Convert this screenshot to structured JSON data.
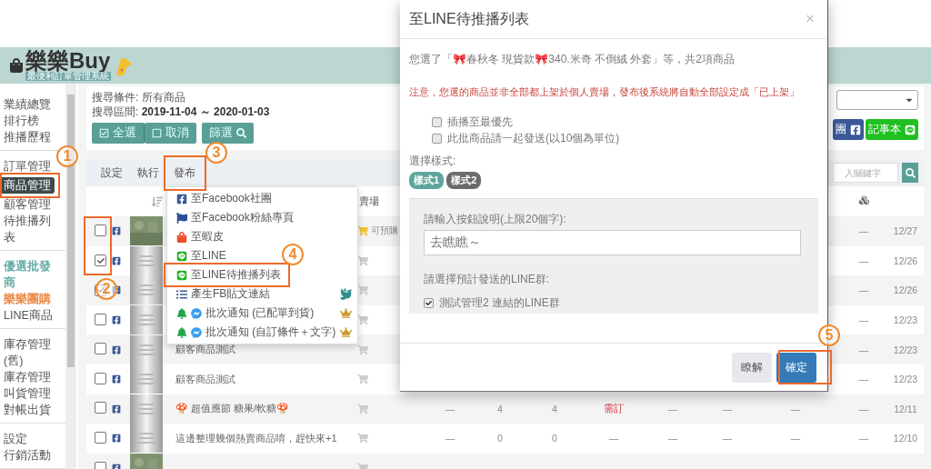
{
  "header": {
    "logo": "樂樂Buy",
    "tagline": "最便利訂單管理系統"
  },
  "sidebar": {
    "groups": [
      [
        {
          "label": "業績總覽",
          "selected": false
        },
        {
          "label": "排行榜",
          "selected": false
        },
        {
          "label": "推播歷程",
          "selected": false
        }
      ],
      [
        {
          "label": "訂單管理",
          "selected": false
        },
        {
          "label": "商品管理",
          "selected": true
        },
        {
          "label": "顧客管理",
          "selected": false
        },
        {
          "label": "待推播列表",
          "selected": false
        }
      ],
      [
        {
          "label": "優選批發商",
          "selected": false,
          "color": "#5aa8a0"
        },
        {
          "label": "樂樂團購",
          "selected": false,
          "color": "#e8823a"
        },
        {
          "label": "LINE商品",
          "selected": false
        }
      ],
      [
        {
          "label": "庫存管理(舊)",
          "selected": false
        },
        {
          "label": "庫存管理",
          "selected": false
        },
        {
          "label": "叫貨管理",
          "selected": false
        },
        {
          "label": "對帳出貨",
          "selected": false
        }
      ],
      [
        {
          "label": "設定",
          "selected": false
        },
        {
          "label": "行銷活動",
          "selected": false
        }
      ]
    ]
  },
  "search": {
    "condition": "搜尋條件: 所有商品",
    "range": "搜尋區間: **2019-11-04 ～ 2020-01-03**",
    "buttons": [
      {
        "label": "全選",
        "kind": "check"
      },
      {
        "label": "取消",
        "kind": "uncheck"
      }
    ],
    "filter": "篩選"
  },
  "share_buttons": [
    {
      "label": "團",
      "kind": "facebook"
    },
    {
      "label": "記事本",
      "kind": "line"
    }
  ],
  "toolbar": {
    "tabs": [
      {
        "label": "設定"
      },
      {
        "label": "執行"
      },
      {
        "label": "發布"
      }
    ],
    "search_placeholder": "入關鍵字"
  },
  "table": {
    "store_heading": "賣場",
    "rows": [
      {
        "checked": false,
        "preorder": "可預購",
        "cells": [
          "—",
          "12/27"
        ]
      },
      {
        "checked": true,
        "kind": "placeholder",
        "cells": [
          "—",
          "12/26"
        ]
      },
      {
        "checked": true,
        "kind": "placeholder",
        "cells": [
          "—",
          "12/26"
        ]
      },
      {
        "checked": false,
        "kind": "placeholder",
        "cells": [
          "—",
          "12/23"
        ]
      },
      {
        "checked": false,
        "kind": "placeholder",
        "title": "顧客商品測試",
        "cells": [
          "—",
          "12/23"
        ]
      },
      {
        "checked": false,
        "kind": "placeholder",
        "title": "顧客商品測試",
        "cells": [
          "—",
          "12/23"
        ]
      },
      {
        "checked": false,
        "kind": "placeholder",
        "title": "🍄 超值應節 糖果/軟糖🍄",
        "cells": [
          "—",
          "4",
          "4",
          "需訂",
          "—",
          "—",
          "—",
          "—",
          "12/11"
        ]
      },
      {
        "checked": false,
        "kind": "placeholder",
        "title": "這邊整理幾個熱賣商品唷，趕快來+1",
        "cells": [
          "—",
          "0",
          "0",
          "—",
          "—",
          "—",
          "—",
          "—",
          "12/10"
        ]
      },
      {
        "checked": false,
        "cells": []
      }
    ]
  },
  "menu": {
    "items": [
      {
        "kind": "facebook",
        "label": "至Facebook社團"
      },
      {
        "kind": "flag",
        "label": "至Facebook粉絲專頁"
      },
      {
        "kind": "shop",
        "label": "至蝦皮"
      },
      {
        "kind": "line",
        "label": "至LINE"
      },
      {
        "kind": "line",
        "label": "至LINE待推播列表"
      },
      {
        "kind": "list",
        "label": "產生FB貼文連結"
      },
      {
        "kind": "notify",
        "label": "批次通知 (已配單到貨)"
      },
      {
        "kind": "notify",
        "label": "批次通知 (自訂條件＋文字)"
      }
    ]
  },
  "dialog": {
    "title": "至LINE待推播列表",
    "close": "×",
    "summary": "您選了「🎀春秋冬 現貨款🎀340.米奇 不倒絨 外套」等，共2項商品",
    "warning": "注意，您選的商品並非全部都上架於個人賣場，發布後系統將自動全部設定成「已上架」",
    "options": [
      {
        "label": "插播至最優先",
        "checked": false
      },
      {
        "label": "此批商品請一起發送(以10個為單位)",
        "checked": false
      }
    ],
    "style_label": "選擇樣式:",
    "styles": [
      {
        "label": "樣式1",
        "selected": true
      },
      {
        "label": "樣式2",
        "selected": false
      }
    ],
    "button_text_label": "請輸入按鈕說明(上限20個字):",
    "button_text": "去瞧瞧～",
    "group_label": "請選擇預計發送的LINE群:",
    "groups": [
      {
        "label": "測試管理2 連結的LINE群",
        "checked": true
      }
    ],
    "buttons": [
      {
        "label": "瞭解",
        "kind": "secondary"
      },
      {
        "label": "確定",
        "kind": "primary"
      }
    ]
  },
  "annotations": [
    {
      "label": "1"
    },
    {
      "label": "2"
    },
    {
      "label": "3"
    },
    {
      "label": "4"
    },
    {
      "label": "5"
    }
  ]
}
